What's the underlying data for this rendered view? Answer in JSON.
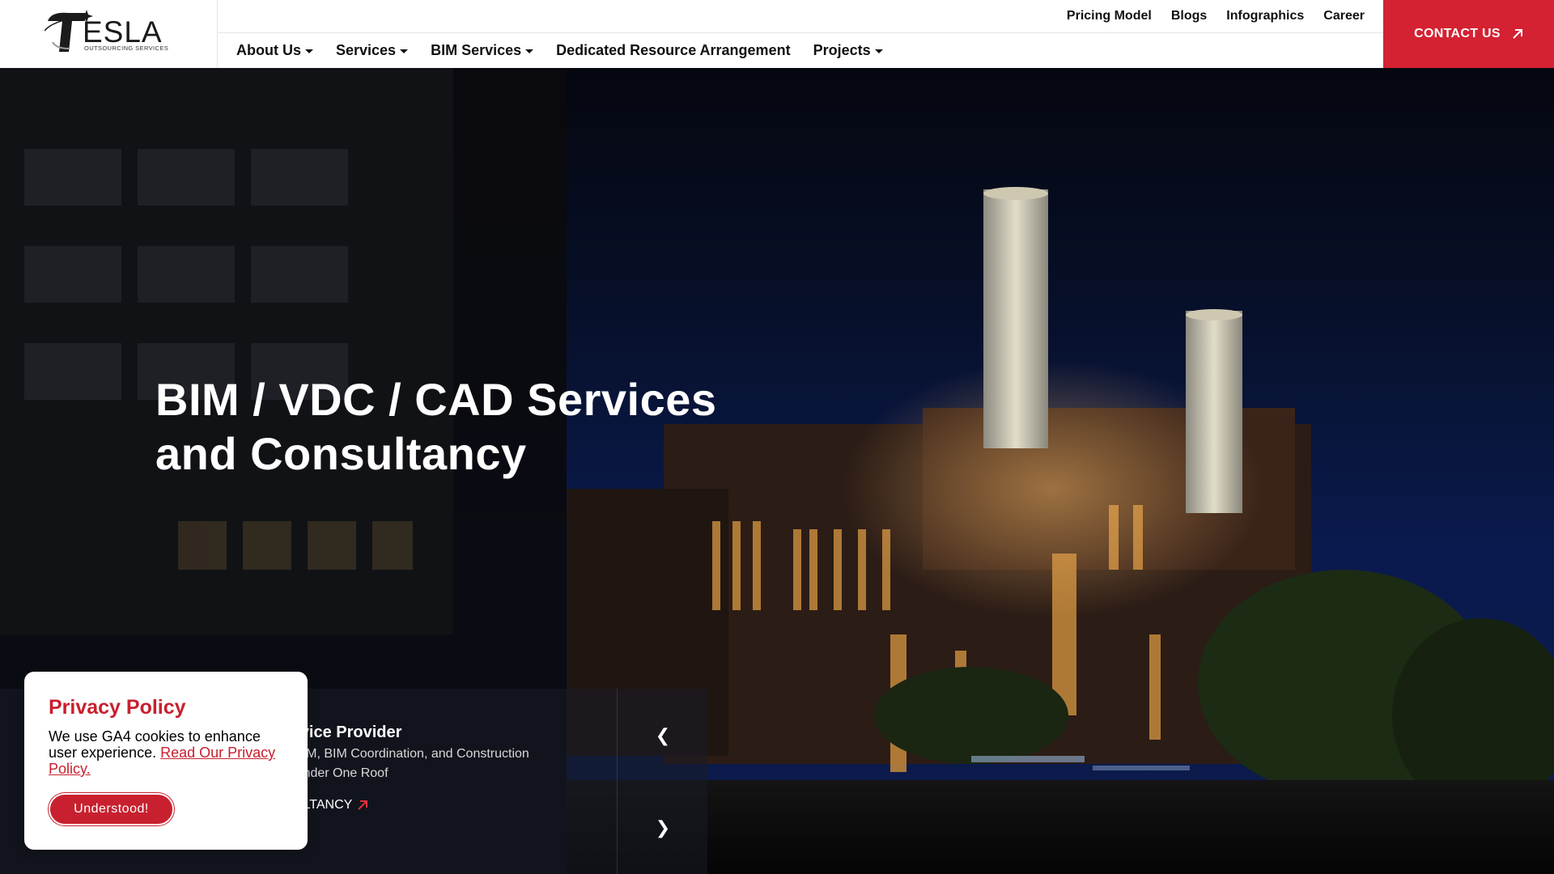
{
  "logo": {
    "word": "ESLA",
    "sub": "OUTSOURCING SERVICES"
  },
  "top_links": [
    "Pricing Model",
    "Blogs",
    "Infographics",
    "Career"
  ],
  "nav": {
    "about": "About Us",
    "services": "Services",
    "bim": "BIM Services",
    "dedicated": "Dedicated Resource Arrangement",
    "projects": "Projects"
  },
  "contact_label": "CONTACT US",
  "hero": {
    "title_line1": "BIM / VDC / CAD Services",
    "title_line2": "and Consultancy"
  },
  "slide": {
    "heading": "rvice Provider",
    "desc_line1": "BIM, BIM Coordination, and Construction",
    "desc_line2": "Under One Roof",
    "link_label": "ULTANCY",
    "prev": "❮",
    "next": "❯"
  },
  "privacy": {
    "title": "Privacy Policy",
    "text": "We use GA4 cookies to enhance user experience.",
    "link": "Read Our Privacy Policy.",
    "button": "Understood!"
  },
  "colors": {
    "accent": "#d42232",
    "header_bg": "#ffffff",
    "hero_sky": "#0a1a4e"
  }
}
